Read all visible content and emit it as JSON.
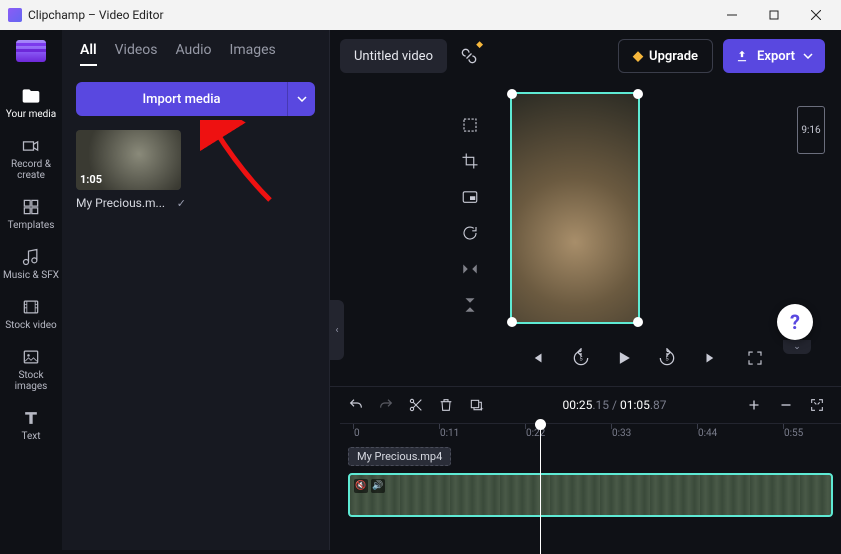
{
  "titlebar": {
    "title": "Clipchamp – Video Editor"
  },
  "sidebar": {
    "items": [
      {
        "label": "Your media"
      },
      {
        "label": "Record & create"
      },
      {
        "label": "Templates"
      },
      {
        "label": "Music & SFX"
      },
      {
        "label": "Stock video"
      },
      {
        "label": "Stock images"
      },
      {
        "label": "Text"
      }
    ]
  },
  "panel": {
    "tabs": [
      "All",
      "Videos",
      "Audio",
      "Images"
    ],
    "active_tab": 0,
    "import_label": "Import media",
    "media": {
      "duration": "1:05",
      "name": "My Precious.m..."
    }
  },
  "header": {
    "title": "Untitled video",
    "upgrade": "Upgrade",
    "export": "Export"
  },
  "preview": {
    "aspect_label": "9:16"
  },
  "timeline": {
    "timecode_current": "00:25",
    "timecode_current_dec": ".15",
    "timecode_total": "01:05",
    "timecode_total_dec": ".87",
    "ruler": [
      "0",
      "0:11",
      "0:22",
      "0:33",
      "0:44",
      "0:55"
    ],
    "clip_label": "My Precious.mp4"
  },
  "help": {
    "label": "?"
  }
}
